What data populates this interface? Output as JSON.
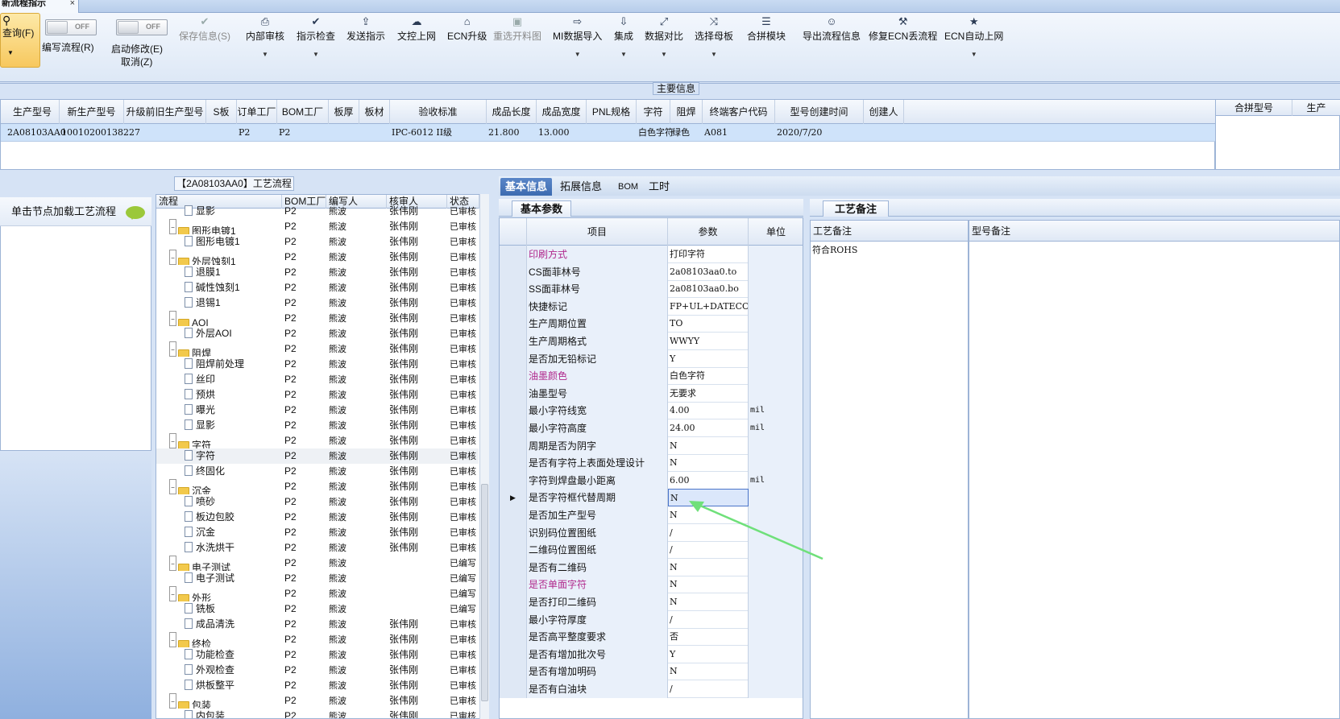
{
  "doc_tab": {
    "title": "新流程指示",
    "close": "×"
  },
  "toolbar": {
    "query": {
      "label": "查询(F)"
    },
    "toggle_off": "OFF",
    "edit_flow": "编写流程(R)",
    "start_modify": "启动修改(E)",
    "cancel": "取消(Z)",
    "buttons": [
      {
        "label": "保存信息(S)",
        "disabled": true
      },
      {
        "label": "内部审核"
      },
      {
        "label": "指示检查"
      },
      {
        "label": "发送指示"
      },
      {
        "label": "文控上网"
      },
      {
        "label": "ECN升级"
      },
      {
        "label": "重选开料图",
        "disabled": true
      },
      {
        "label": "MI数据导入"
      },
      {
        "label": "集成"
      },
      {
        "label": "数据对比"
      },
      {
        "label": "选择母板"
      },
      {
        "label": "合拼模块"
      },
      {
        "label": "导出流程信息"
      },
      {
        "label": "修复ECN丢流程"
      },
      {
        "label": "ECN自动上网"
      }
    ],
    "icons": [
      "printer-icon",
      "check-icon",
      "upload-icon",
      "cloud-icon",
      "ecn-icon",
      "image-icon",
      "import-icon",
      "integrate-icon",
      "compare-icon",
      "shuffle-icon",
      "list-icon",
      "smile-icon",
      "wrench-icon",
      "star-icon"
    ]
  },
  "main_info_label": "主要信息",
  "top_grid": {
    "columns": [
      "生产型号",
      "新生产型号",
      "升级前旧生产型号",
      "S板",
      "订单工厂",
      "BOM工厂",
      "板厚",
      "板材",
      "验收标准",
      "成品长度",
      "成品宽度",
      "PNL规格",
      "字符",
      "阻焊",
      "终端客户代码",
      "型号创建时间",
      "创建人"
    ],
    "row": [
      "2A08103AA0",
      "10010200138227",
      "",
      "",
      "P2",
      "P2",
      "",
      "",
      "IPC-6012 II级",
      "21.800",
      "13.000",
      "",
      "白色字符",
      "绿色",
      "A081",
      "2020/7/20",
      ""
    ],
    "right_columns": [
      "合拼型号",
      "生产"
    ]
  },
  "left_panel": {
    "hint": "单击节点加载工艺流程"
  },
  "tree": {
    "title": "【2A08103AA0】工艺流程",
    "columns": [
      "流程",
      "BOM工厂",
      "编写人",
      "核审人",
      "状态"
    ],
    "rows": [
      {
        "name": "显影",
        "level": 2,
        "type": "file",
        "bom": "P2",
        "writer": "熊波",
        "reviewer": "张伟刚",
        "status": "已审核"
      },
      {
        "name": "图形电镀1",
        "level": 1,
        "type": "folder",
        "bom": "P2",
        "writer": "熊波",
        "reviewer": "张伟刚",
        "status": "已审核"
      },
      {
        "name": "图形电镀1",
        "level": 2,
        "type": "file",
        "bom": "P2",
        "writer": "熊波",
        "reviewer": "张伟刚",
        "status": "已审核"
      },
      {
        "name": "外层蚀刻1",
        "level": 1,
        "type": "folder",
        "bom": "P2",
        "writer": "熊波",
        "reviewer": "张伟刚",
        "status": "已审核"
      },
      {
        "name": "退膜1",
        "level": 2,
        "type": "file",
        "bom": "P2",
        "writer": "熊波",
        "reviewer": "张伟刚",
        "status": "已审核"
      },
      {
        "name": "碱性蚀刻1",
        "level": 2,
        "type": "file",
        "bom": "P2",
        "writer": "熊波",
        "reviewer": "张伟刚",
        "status": "已审核"
      },
      {
        "name": "退锡1",
        "level": 2,
        "type": "file",
        "bom": "P2",
        "writer": "熊波",
        "reviewer": "张伟刚",
        "status": "已审核"
      },
      {
        "name": "AOI",
        "level": 1,
        "type": "folder",
        "bom": "P2",
        "writer": "熊波",
        "reviewer": "张伟刚",
        "status": "已审核"
      },
      {
        "name": "外层AOI",
        "level": 2,
        "type": "file",
        "bom": "P2",
        "writer": "熊波",
        "reviewer": "张伟刚",
        "status": "已审核"
      },
      {
        "name": "阻焊",
        "level": 1,
        "type": "folder",
        "bom": "P2",
        "writer": "熊波",
        "reviewer": "张伟刚",
        "status": "已审核"
      },
      {
        "name": "阻焊前处理",
        "level": 2,
        "type": "file",
        "bom": "P2",
        "writer": "熊波",
        "reviewer": "张伟刚",
        "status": "已审核"
      },
      {
        "name": "丝印",
        "level": 2,
        "type": "file",
        "bom": "P2",
        "writer": "熊波",
        "reviewer": "张伟刚",
        "status": "已审核"
      },
      {
        "name": "预烘",
        "level": 2,
        "type": "file",
        "bom": "P2",
        "writer": "熊波",
        "reviewer": "张伟刚",
        "status": "已审核"
      },
      {
        "name": "曝光",
        "level": 2,
        "type": "file",
        "bom": "P2",
        "writer": "熊波",
        "reviewer": "张伟刚",
        "status": "已审核"
      },
      {
        "name": "显影",
        "level": 2,
        "type": "file",
        "bom": "P2",
        "writer": "熊波",
        "reviewer": "张伟刚",
        "status": "已审核"
      },
      {
        "name": "字符",
        "level": 1,
        "type": "folder",
        "bom": "P2",
        "writer": "熊波",
        "reviewer": "张伟刚",
        "status": "已审核"
      },
      {
        "name": "字符",
        "level": 2,
        "type": "file",
        "bom": "P2",
        "writer": "熊波",
        "reviewer": "张伟刚",
        "status": "已审核",
        "selected": true
      },
      {
        "name": "终固化",
        "level": 2,
        "type": "file",
        "bom": "P2",
        "writer": "熊波",
        "reviewer": "张伟刚",
        "status": "已审核"
      },
      {
        "name": "沉金",
        "level": 1,
        "type": "folder",
        "bom": "P2",
        "writer": "熊波",
        "reviewer": "张伟刚",
        "status": "已审核"
      },
      {
        "name": "喷砂",
        "level": 2,
        "type": "file",
        "bom": "P2",
        "writer": "熊波",
        "reviewer": "张伟刚",
        "status": "已审核"
      },
      {
        "name": "板边包胶",
        "level": 2,
        "type": "file",
        "bom": "P2",
        "writer": "熊波",
        "reviewer": "张伟刚",
        "status": "已审核"
      },
      {
        "name": "沉金",
        "level": 2,
        "type": "file",
        "bom": "P2",
        "writer": "熊波",
        "reviewer": "张伟刚",
        "status": "已审核"
      },
      {
        "name": "水洗烘干",
        "level": 2,
        "type": "file",
        "bom": "P2",
        "writer": "熊波",
        "reviewer": "张伟刚",
        "status": "已审核"
      },
      {
        "name": "电子测试",
        "level": 1,
        "type": "folder",
        "bom": "P2",
        "writer": "熊波",
        "reviewer": "",
        "status": "已编写"
      },
      {
        "name": "电子测试",
        "level": 2,
        "type": "file",
        "bom": "P2",
        "writer": "熊波",
        "reviewer": "",
        "status": "已编写"
      },
      {
        "name": "外形",
        "level": 1,
        "type": "folder",
        "bom": "P2",
        "writer": "熊波",
        "reviewer": "",
        "status": "已编写"
      },
      {
        "name": "铣板",
        "level": 2,
        "type": "file",
        "bom": "P2",
        "writer": "熊波",
        "reviewer": "",
        "status": "已编写"
      },
      {
        "name": "成品清洗",
        "level": 2,
        "type": "file",
        "bom": "P2",
        "writer": "熊波",
        "reviewer": "张伟刚",
        "status": "已审核"
      },
      {
        "name": "终检",
        "level": 1,
        "type": "folder",
        "bom": "P2",
        "writer": "熊波",
        "reviewer": "张伟刚",
        "status": "已审核"
      },
      {
        "name": "功能检查",
        "level": 2,
        "type": "file",
        "bom": "P2",
        "writer": "熊波",
        "reviewer": "张伟刚",
        "status": "已审核"
      },
      {
        "name": "外观检查",
        "level": 2,
        "type": "file",
        "bom": "P2",
        "writer": "熊波",
        "reviewer": "张伟刚",
        "status": "已审核"
      },
      {
        "name": "烘板整平",
        "level": 2,
        "type": "file",
        "bom": "P2",
        "writer": "熊波",
        "reviewer": "张伟刚",
        "status": "已审核"
      },
      {
        "name": "包装",
        "level": 1,
        "type": "folder",
        "bom": "P2",
        "writer": "熊波",
        "reviewer": "张伟刚",
        "status": "已审核"
      },
      {
        "name": "内包装",
        "level": 2,
        "type": "file",
        "bom": "P2",
        "writer": "熊波",
        "reviewer": "张伟刚",
        "status": "已审核"
      }
    ]
  },
  "detail_tabs": [
    "基本信息",
    "拓展信息",
    "BOM",
    "工时"
  ],
  "params": {
    "title": "基本参数",
    "columns": [
      "项目",
      "参数",
      "单位"
    ],
    "rows": [
      {
        "item": "印刷方式",
        "value": "打印字符",
        "unit": "",
        "pink": true
      },
      {
        "item": "CS面菲林号",
        "value": "2a08103aa0.to",
        "unit": ""
      },
      {
        "item": "SS面菲林号",
        "value": "2a08103aa0.bo",
        "unit": ""
      },
      {
        "item": "快捷标记",
        "value": "FP+UL+DATECODE",
        "unit": ""
      },
      {
        "item": "生产周期位置",
        "value": "TO",
        "unit": ""
      },
      {
        "item": "生产周期格式",
        "value": "WWYY",
        "unit": ""
      },
      {
        "item": "是否加无铅标记",
        "value": "Y",
        "unit": ""
      },
      {
        "item": "油墨颜色",
        "value": "白色字符",
        "unit": "",
        "pink": true
      },
      {
        "item": "油墨型号",
        "value": "无要求",
        "unit": ""
      },
      {
        "item": "最小字符线宽",
        "value": "4.00",
        "unit": "mil"
      },
      {
        "item": "最小字符高度",
        "value": "24.00",
        "unit": "mil"
      },
      {
        "item": "周期是否为阴字",
        "value": "N",
        "unit": ""
      },
      {
        "item": "是否有字符上表面处理设计",
        "value": "N",
        "unit": ""
      },
      {
        "item": "字符到焊盘最小距离",
        "value": "6.00",
        "unit": "mil"
      },
      {
        "item": "是否字符框代替周期",
        "value": "N",
        "unit": "",
        "current": true
      },
      {
        "item": "是否加生产型号",
        "value": "N",
        "unit": ""
      },
      {
        "item": "识别码位置图纸",
        "value": "/",
        "unit": ""
      },
      {
        "item": "二维码位置图纸",
        "value": "/",
        "unit": ""
      },
      {
        "item": "是否有二维码",
        "value": "N",
        "unit": ""
      },
      {
        "item": "是否单面字符",
        "value": "N",
        "unit": "",
        "pink": true
      },
      {
        "item": "是否打印二维码",
        "value": "N",
        "unit": ""
      },
      {
        "item": "最小字符厚度",
        "value": "/",
        "unit": ""
      },
      {
        "item": "是否高平整度要求",
        "value": "否",
        "unit": ""
      },
      {
        "item": "是否有增加批次号",
        "value": "Y",
        "unit": ""
      },
      {
        "item": "是否有增加明码",
        "value": "N",
        "unit": ""
      },
      {
        "item": "是否有白油块",
        "value": "/",
        "unit": ""
      }
    ]
  },
  "notes": {
    "title": "工艺备注",
    "col1": "工艺备注",
    "col1_text": "符合ROHS",
    "col2": "型号备注"
  },
  "colors": {
    "accent": "#3c6bb0",
    "annotation_arrow": "#6fe07a",
    "pink": "#b0288c"
  }
}
